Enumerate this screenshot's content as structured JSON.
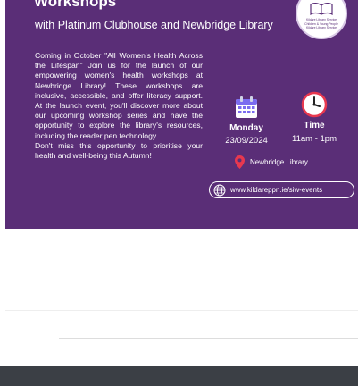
{
  "poster": {
    "title": "Workshops",
    "subtitle": "with Platinum Clubhouse and Newbridge Library",
    "body_paragraph_1": "Coming in October \"All Women's Health Across the Lifespan\" Join us for the launch of our empowering women's health workshops at Newbridge Library! These workshops are inclusive, accessible, and offer literacy support. At the launch event, you'll discover more about our upcoming workshop series and have the opportunity to explore the library's resources, including the reader pen technology.",
    "body_paragraph_2": "Don't miss this opportunity to prioritise your health and well-being this Autumn!",
    "badge_lines": [
      "Kildare Library Service",
      "Children & Young People",
      "Kildare Library Service"
    ],
    "event": {
      "day": "Monday",
      "date": "23/09/2024",
      "time_label": "Time",
      "time_value": "11am - 1pm",
      "location": "Newbridge Library",
      "url": "www.kildareppn.ie/siw-events"
    },
    "icons": {
      "calendar": "calendar-icon",
      "clock": "clock-icon",
      "location": "map-pin-icon",
      "globe": "globe-icon",
      "badge": "open-book-logo"
    },
    "colors": {
      "background": "#5a2e77",
      "text": "#ffffff",
      "pin": "#e8384f",
      "calendar": "#7b6cf0"
    }
  }
}
